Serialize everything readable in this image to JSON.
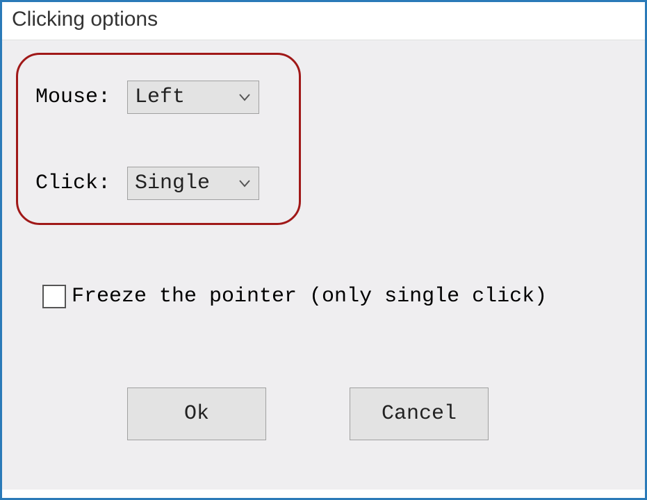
{
  "window": {
    "title": "Clicking options"
  },
  "fields": {
    "mouse_label": "Mouse:",
    "mouse_value": "Left",
    "click_label": "Click:",
    "click_value": "Single"
  },
  "checkbox": {
    "label": "Freeze the pointer (only single click)"
  },
  "buttons": {
    "ok": "Ok",
    "cancel": "Cancel"
  }
}
